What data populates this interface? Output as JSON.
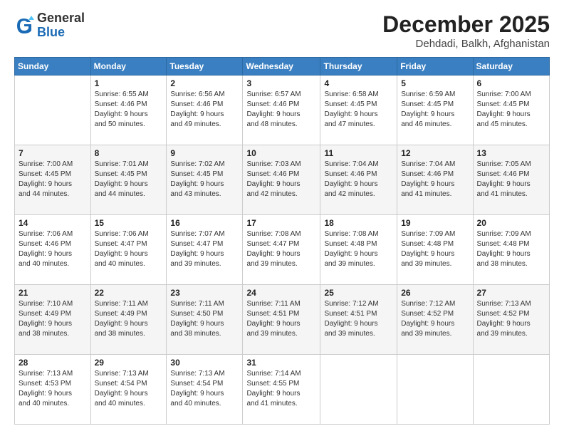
{
  "header": {
    "logo_general": "General",
    "logo_blue": "Blue",
    "month_title": "December 2025",
    "location": "Dehdadi, Balkh, Afghanistan"
  },
  "days_of_week": [
    "Sunday",
    "Monday",
    "Tuesday",
    "Wednesday",
    "Thursday",
    "Friday",
    "Saturday"
  ],
  "weeks": [
    [
      {
        "day": "",
        "info": ""
      },
      {
        "day": "1",
        "info": "Sunrise: 6:55 AM\nSunset: 4:46 PM\nDaylight: 9 hours\nand 50 minutes."
      },
      {
        "day": "2",
        "info": "Sunrise: 6:56 AM\nSunset: 4:46 PM\nDaylight: 9 hours\nand 49 minutes."
      },
      {
        "day": "3",
        "info": "Sunrise: 6:57 AM\nSunset: 4:46 PM\nDaylight: 9 hours\nand 48 minutes."
      },
      {
        "day": "4",
        "info": "Sunrise: 6:58 AM\nSunset: 4:45 PM\nDaylight: 9 hours\nand 47 minutes."
      },
      {
        "day": "5",
        "info": "Sunrise: 6:59 AM\nSunset: 4:45 PM\nDaylight: 9 hours\nand 46 minutes."
      },
      {
        "day": "6",
        "info": "Sunrise: 7:00 AM\nSunset: 4:45 PM\nDaylight: 9 hours\nand 45 minutes."
      }
    ],
    [
      {
        "day": "7",
        "info": "Sunrise: 7:00 AM\nSunset: 4:45 PM\nDaylight: 9 hours\nand 44 minutes."
      },
      {
        "day": "8",
        "info": "Sunrise: 7:01 AM\nSunset: 4:45 PM\nDaylight: 9 hours\nand 44 minutes."
      },
      {
        "day": "9",
        "info": "Sunrise: 7:02 AM\nSunset: 4:45 PM\nDaylight: 9 hours\nand 43 minutes."
      },
      {
        "day": "10",
        "info": "Sunrise: 7:03 AM\nSunset: 4:46 PM\nDaylight: 9 hours\nand 42 minutes."
      },
      {
        "day": "11",
        "info": "Sunrise: 7:04 AM\nSunset: 4:46 PM\nDaylight: 9 hours\nand 42 minutes."
      },
      {
        "day": "12",
        "info": "Sunrise: 7:04 AM\nSunset: 4:46 PM\nDaylight: 9 hours\nand 41 minutes."
      },
      {
        "day": "13",
        "info": "Sunrise: 7:05 AM\nSunset: 4:46 PM\nDaylight: 9 hours\nand 41 minutes."
      }
    ],
    [
      {
        "day": "14",
        "info": "Sunrise: 7:06 AM\nSunset: 4:46 PM\nDaylight: 9 hours\nand 40 minutes."
      },
      {
        "day": "15",
        "info": "Sunrise: 7:06 AM\nSunset: 4:47 PM\nDaylight: 9 hours\nand 40 minutes."
      },
      {
        "day": "16",
        "info": "Sunrise: 7:07 AM\nSunset: 4:47 PM\nDaylight: 9 hours\nand 39 minutes."
      },
      {
        "day": "17",
        "info": "Sunrise: 7:08 AM\nSunset: 4:47 PM\nDaylight: 9 hours\nand 39 minutes."
      },
      {
        "day": "18",
        "info": "Sunrise: 7:08 AM\nSunset: 4:48 PM\nDaylight: 9 hours\nand 39 minutes."
      },
      {
        "day": "19",
        "info": "Sunrise: 7:09 AM\nSunset: 4:48 PM\nDaylight: 9 hours\nand 39 minutes."
      },
      {
        "day": "20",
        "info": "Sunrise: 7:09 AM\nSunset: 4:48 PM\nDaylight: 9 hours\nand 38 minutes."
      }
    ],
    [
      {
        "day": "21",
        "info": "Sunrise: 7:10 AM\nSunset: 4:49 PM\nDaylight: 9 hours\nand 38 minutes."
      },
      {
        "day": "22",
        "info": "Sunrise: 7:11 AM\nSunset: 4:49 PM\nDaylight: 9 hours\nand 38 minutes."
      },
      {
        "day": "23",
        "info": "Sunrise: 7:11 AM\nSunset: 4:50 PM\nDaylight: 9 hours\nand 38 minutes."
      },
      {
        "day": "24",
        "info": "Sunrise: 7:11 AM\nSunset: 4:51 PM\nDaylight: 9 hours\nand 39 minutes."
      },
      {
        "day": "25",
        "info": "Sunrise: 7:12 AM\nSunset: 4:51 PM\nDaylight: 9 hours\nand 39 minutes."
      },
      {
        "day": "26",
        "info": "Sunrise: 7:12 AM\nSunset: 4:52 PM\nDaylight: 9 hours\nand 39 minutes."
      },
      {
        "day": "27",
        "info": "Sunrise: 7:13 AM\nSunset: 4:52 PM\nDaylight: 9 hours\nand 39 minutes."
      }
    ],
    [
      {
        "day": "28",
        "info": "Sunrise: 7:13 AM\nSunset: 4:53 PM\nDaylight: 9 hours\nand 40 minutes."
      },
      {
        "day": "29",
        "info": "Sunrise: 7:13 AM\nSunset: 4:54 PM\nDaylight: 9 hours\nand 40 minutes."
      },
      {
        "day": "30",
        "info": "Sunrise: 7:13 AM\nSunset: 4:54 PM\nDaylight: 9 hours\nand 40 minutes."
      },
      {
        "day": "31",
        "info": "Sunrise: 7:14 AM\nSunset: 4:55 PM\nDaylight: 9 hours\nand 41 minutes."
      },
      {
        "day": "",
        "info": ""
      },
      {
        "day": "",
        "info": ""
      },
      {
        "day": "",
        "info": ""
      }
    ]
  ]
}
